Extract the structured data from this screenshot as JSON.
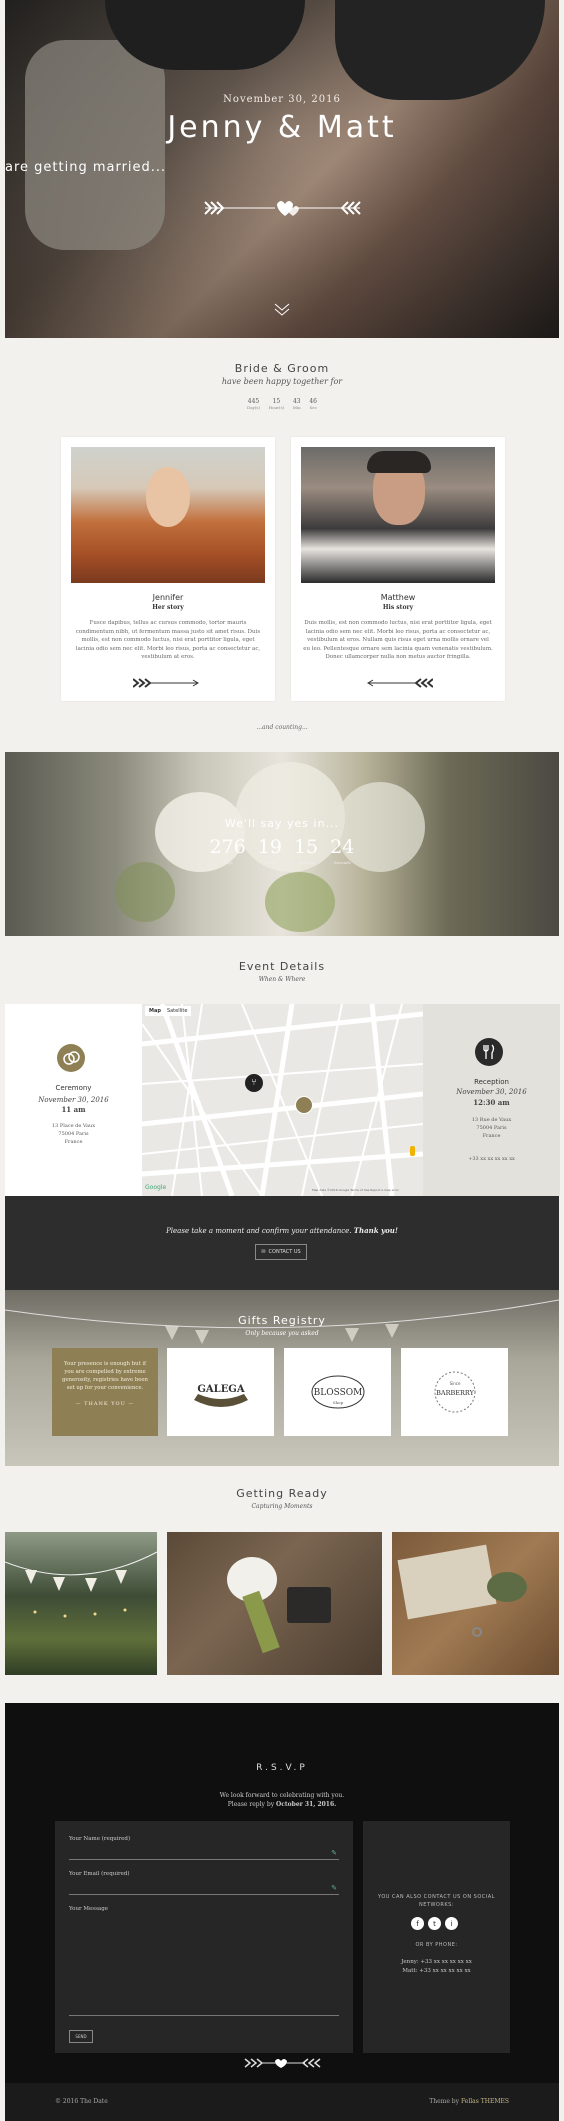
{
  "hero": {
    "date": "November 30, 2016",
    "names": "Jenny & Matt",
    "tagline": "are getting married..."
  },
  "bride_groom": {
    "title": "Bride & Groom",
    "subtitle": "have been happy together for",
    "counter": [
      {
        "value": "445",
        "label": "Day(s)"
      },
      {
        "value": "15",
        "label": "Hour(s)"
      },
      {
        "value": "43",
        "label": "Min"
      },
      {
        "value": "46",
        "label": "Sec"
      }
    ],
    "bride": {
      "name": "Jennifer",
      "role": "Her story",
      "text": "Fusce dapibus, tellus ac cursus commodo, tortor mauris condimentum nibh, ut fermentum massa justo sit amet risus. Duis mollis, est non commodo luctus, nisi erat porttitor ligula, eget lacinia odio sem nec elit. Morbi leo risus, porta ac consectetur ac, vestibulum at eros."
    },
    "groom": {
      "name": "Matthew",
      "role": "His story",
      "text": "Duis mollis, est non commodo luctus, nisi erat porttitor ligula, eget lacinia odio sem nec elit. Morbi leo risus, porta ac consectetur ac, vestibulum at eros. Nullam quis risus eget urna mollis ornare vel eu leo. Pellentesque ornare sem lacinia quam venenatis vestibulum. Donec ullamcorper nulla non metus auctor fringilla."
    },
    "counting": "...and counting..."
  },
  "countdown": {
    "title": "We'll say yes in...",
    "values": [
      {
        "value": "276",
        "label": "Days"
      },
      {
        "value": "19",
        "label": "Hours"
      },
      {
        "value": "15",
        "label": "Minutes"
      },
      {
        "value": "24",
        "label": "Seconds"
      }
    ]
  },
  "events": {
    "title": "Event Details",
    "subtitle": "When & Where",
    "ceremony": {
      "title": "Ceremony",
      "date": "November 30, 2016",
      "time": "11 am",
      "address": [
        "13 Place de Vaux",
        "75004 Paris",
        "France"
      ]
    },
    "reception": {
      "title": "Reception",
      "date": "November 30, 2016",
      "time": "12:30 am",
      "address": [
        "13 Rue de Vaux",
        "75004 Paris",
        "France"
      ],
      "phone": "+33 xx xx xx xx xx"
    },
    "map_tabs": [
      "Map",
      "Satellite"
    ],
    "map_credit": "Google",
    "map_footer": "Map data ©2016 Google    Terms of Use    Report a map error"
  },
  "confirm": {
    "text": "Please take a moment and confirm your attendance.",
    "text_bold": "Thank you!",
    "button": "CONTACT US"
  },
  "gifts": {
    "title": "Gifts Registry",
    "subtitle": "Only because you asked",
    "intro": "Your presence is enough but if you are compelled by extreme generosity, registries have been set up for your convenience.",
    "intro_link": "— THANK YOU —",
    "brands": [
      "GALEGA",
      "BLOSSOM",
      "BARBERRY"
    ],
    "brand_sub": [
      "Shop",
      "Since"
    ]
  },
  "getting_ready": {
    "title": "Getting Ready",
    "subtitle": "Capturing Moments"
  },
  "rsvp": {
    "title": "R.S.V.P",
    "line1": "We look forward to celebrating with you.",
    "line2_prefix": "Please reply by",
    "line2_date": "October 31, 2016.",
    "name_label": "Your Name (required)",
    "email_label": "Your Email (required)",
    "message_label": "Your Message",
    "send": "SEND",
    "side_text": "YOU CAN ALSO CONTACT US ON SOCIAL NETWORKS:",
    "social": [
      "f",
      "t",
      "i"
    ],
    "by_phone": "OR BY PHONE:",
    "phones": [
      "Jenny: +33 xx xx xx xx xx",
      "Matt: +33 xx xx xx xx xx"
    ]
  },
  "footer": {
    "copyright": "© 2016 The Date",
    "theme_prefix": "Theme by",
    "theme_brand": "Fellas THEMES"
  },
  "colors": {
    "accent": "#8e7f54",
    "dark": "#2d2d2d",
    "rsvp_bg": "#0f0f0f"
  }
}
